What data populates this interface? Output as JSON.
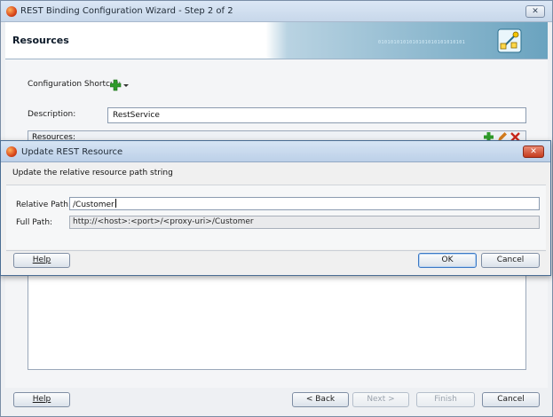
{
  "wizard": {
    "title": "REST Binding Configuration Wizard - Step 2 of 2",
    "close_label": "✕",
    "header_title": "Resources",
    "header_binary": "0101010101010101010101010101",
    "config_shortcut_label": "Configuration Shortcut:",
    "description_label": "Description:",
    "description_value": "RestService",
    "resources_label": "Resources:",
    "buttons": {
      "help": "Help",
      "back": "< Back",
      "next": "Next >",
      "finish": "Finish",
      "cancel": "Cancel"
    }
  },
  "dialog": {
    "title": "Update REST Resource",
    "close_label": "✕",
    "instruction": "Update the relative resource path string",
    "relative_path_label": "Relative Path:",
    "relative_path_value": "/Customer",
    "full_path_label": "Full Path:",
    "full_path_value": "http://<host>:<port>/<proxy-uri>/Customer",
    "buttons": {
      "help": "Help",
      "ok": "OK",
      "cancel": "Cancel"
    }
  },
  "colors": {
    "accent_green": "#2f9a2a",
    "edit_orange": "#d27b1c",
    "delete_red": "#c8261b"
  },
  "icons": {
    "app": "oracle-jdev-icon",
    "add": "green-plus-icon",
    "edit": "pencil-icon",
    "delete": "red-x-icon",
    "header_logo": "wizard-logo-icon"
  }
}
